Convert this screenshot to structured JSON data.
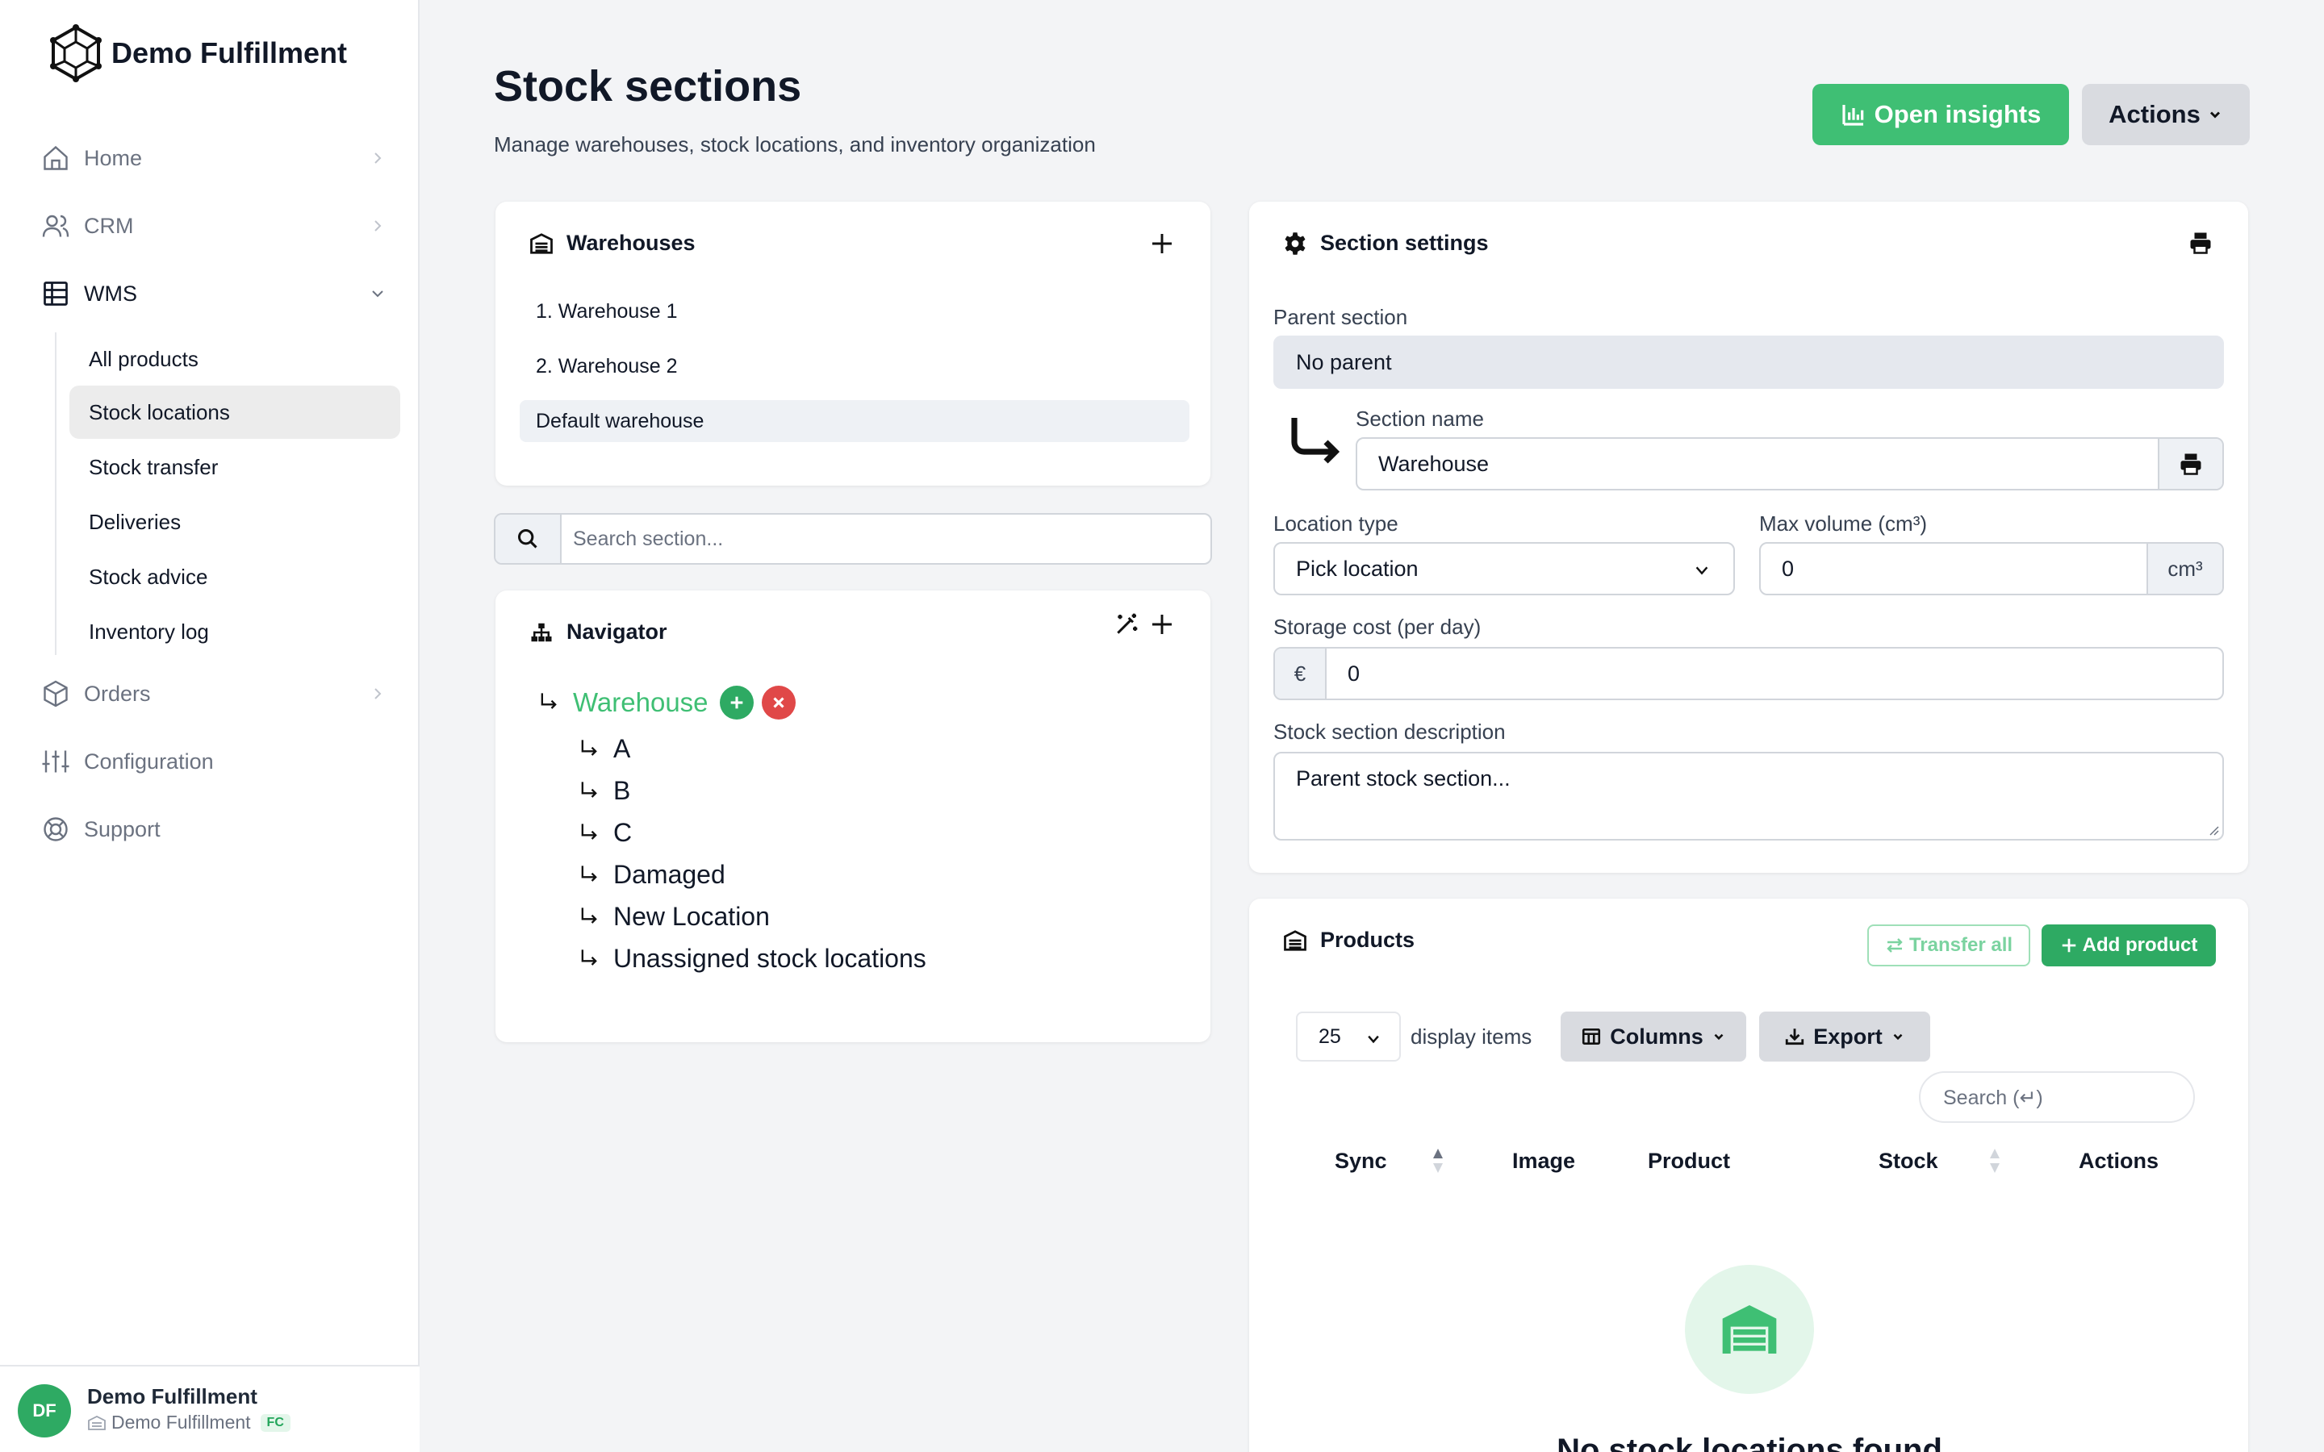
{
  "app": {
    "name": "Demo Fulfillment"
  },
  "sidebar": {
    "home": "Home",
    "crm": "CRM",
    "wms": "WMS",
    "wms_items": [
      "All products",
      "Stock locations",
      "Stock transfer",
      "Deliveries",
      "Stock advice",
      "Inventory log"
    ],
    "orders": "Orders",
    "configuration": "Configuration",
    "support": "Support"
  },
  "user": {
    "initials": "DF",
    "name": "Demo Fulfillment",
    "org": "Demo Fulfillment",
    "badge": "FC"
  },
  "page": {
    "title": "Stock sections",
    "subtitle": "Manage warehouses, stock locations, and inventory organization",
    "insights_label": "Open insights",
    "actions_label": "Actions"
  },
  "warehouses": {
    "title": "Warehouses",
    "items": [
      "1. Warehouse 1",
      "2. Warehouse 2",
      "Default warehouse"
    ]
  },
  "search_section": {
    "placeholder": "Search section..."
  },
  "navigator": {
    "title": "Navigator",
    "root": "Warehouse",
    "children": [
      "A",
      "B",
      "C",
      "Damaged",
      "New Location",
      "Unassigned stock locations"
    ]
  },
  "settings": {
    "title": "Section settings",
    "parent_label": "Parent section",
    "parent_value": "No parent",
    "name_label": "Section name",
    "name_value": "Warehouse",
    "type_label": "Location type",
    "type_value": "Pick location",
    "volume_label": "Max volume (cm³)",
    "volume_value": "0",
    "volume_unit": "cm³",
    "cost_label": "Storage cost (per day)",
    "cost_currency": "€",
    "cost_value": "0",
    "desc_label": "Stock section description",
    "desc_value": "Parent stock section..."
  },
  "products": {
    "title": "Products",
    "transfer_label": "Transfer all",
    "add_label": "Add product",
    "per_page": "25",
    "display_label": "display items",
    "columns_label": "Columns",
    "export_label": "Export",
    "search_placeholder": "Search (↵)",
    "headers": [
      "Sync",
      "Image",
      "Product",
      "Stock",
      "Actions"
    ],
    "empty_text": "No stock locations found"
  },
  "colors": {
    "accent": "#3fbf74",
    "accent_dark": "#2eaa63",
    "danger": "#e04848",
    "sidebar_bg": "#ffffff",
    "page_bg": "#f3f4f6"
  }
}
